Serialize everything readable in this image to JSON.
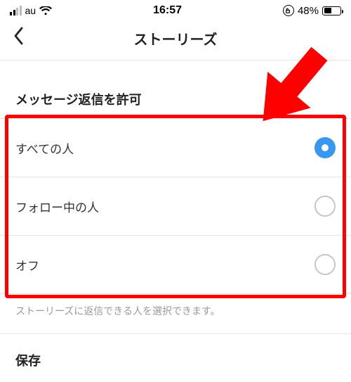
{
  "status_bar": {
    "carrier": "au",
    "time": "16:57",
    "battery_pct": "48%"
  },
  "header": {
    "title": "ストーリーズ"
  },
  "section": {
    "title": "メッセージ返信を許可",
    "options": [
      {
        "label": "すべての人",
        "selected": true
      },
      {
        "label": "フォロー中の人",
        "selected": false
      },
      {
        "label": "オフ",
        "selected": false
      }
    ],
    "hint": "ストーリーズに返信できる人を選択できます。"
  },
  "save_section": {
    "title": "保存"
  },
  "annotation": {
    "highlight_color": "#ff0000"
  }
}
